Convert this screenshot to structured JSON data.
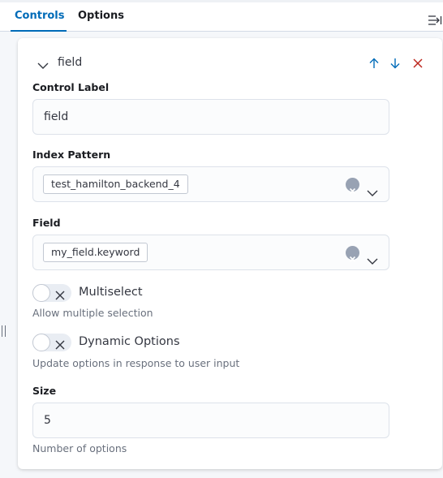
{
  "tabs": [
    {
      "label": "Controls",
      "selected": true
    },
    {
      "label": "Options",
      "selected": false
    }
  ],
  "accent_color": "#006bb8",
  "danger_color": "#bd271e",
  "control": {
    "title": "field",
    "actions": [
      "arrow-up-icon",
      "arrow-down-icon",
      "cross-icon"
    ],
    "control_label": {
      "label": "Control Label",
      "value": "field"
    },
    "index_pattern": {
      "label": "Index Pattern",
      "value": "test_hamilton_backend_4"
    },
    "field": {
      "label": "Field",
      "value": "my_field.keyword"
    },
    "multiselect": {
      "label": "Multiselect",
      "help": "Allow multiple selection",
      "checked": false
    },
    "dynamic_options": {
      "label": "Dynamic Options",
      "help": "Update options in response to user input",
      "checked": false
    },
    "size": {
      "label": "Size",
      "value": "5",
      "help": "Number of options"
    }
  }
}
